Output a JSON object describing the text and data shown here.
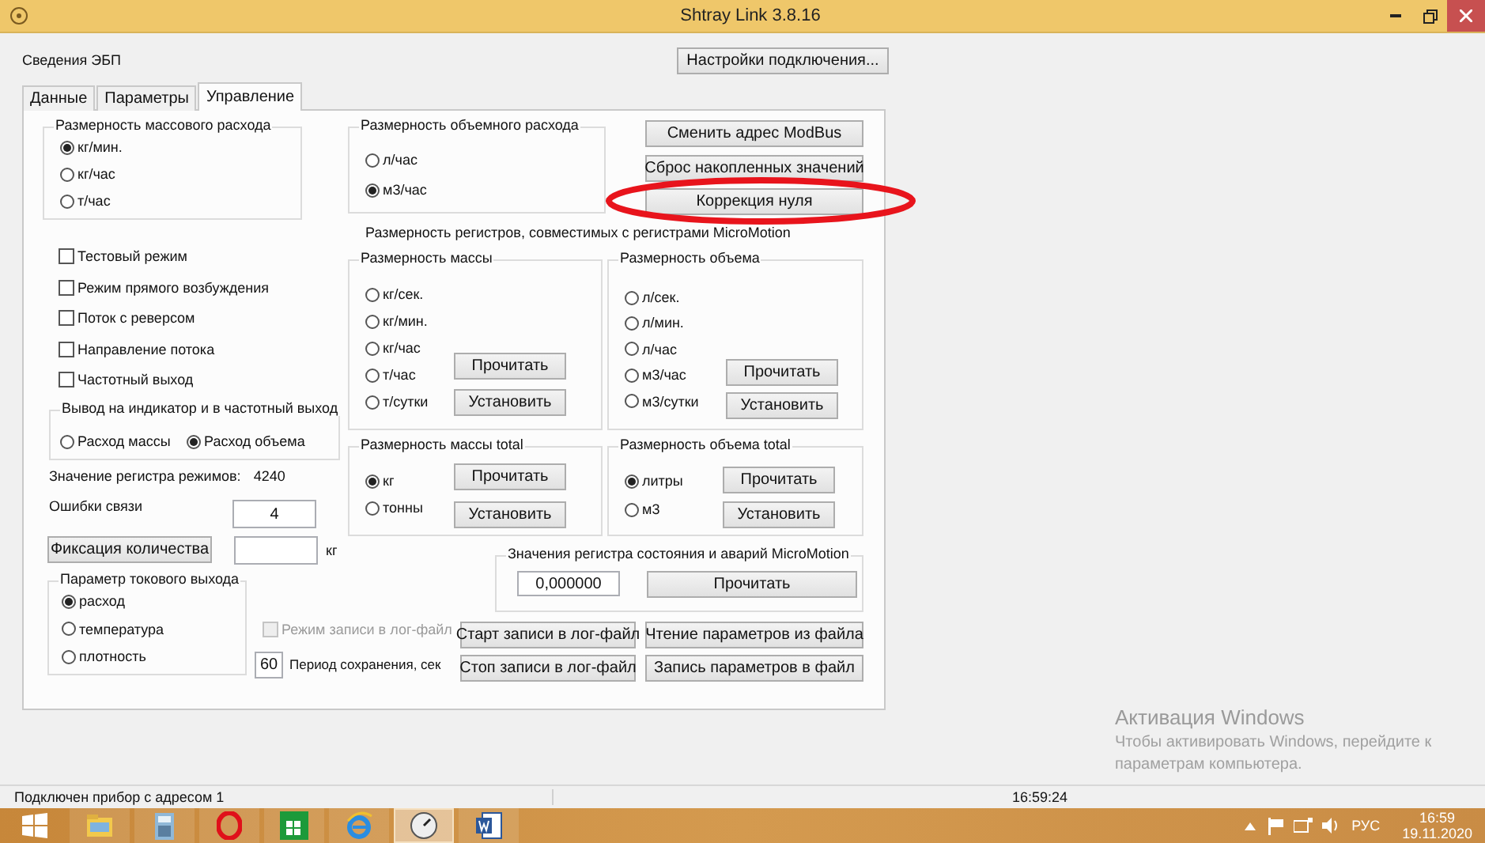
{
  "window": {
    "title": "Shtray Link 3.8.16"
  },
  "device_info_label": "Сведения ЭБП",
  "connection_settings_button": "Настройки подключения...",
  "tabs": [
    {
      "label": "Данные",
      "selected": false
    },
    {
      "label": "Параметры",
      "selected": false
    },
    {
      "label": "Управление",
      "selected": true
    }
  ],
  "mass_flow_units": {
    "title": "Размерность массового расхода",
    "options": [
      {
        "label": "кг/мин.",
        "selected": true
      },
      {
        "label": "кг/час",
        "selected": false
      },
      {
        "label": "т/час",
        "selected": false
      }
    ]
  },
  "volume_flow_units": {
    "title": "Размерность объемного расхода",
    "options": [
      {
        "label": "л/час",
        "selected": false
      },
      {
        "label": "м3/час",
        "selected": true
      }
    ]
  },
  "action_buttons": [
    "Сменить адрес ModBus",
    "Сброс накопленных значений",
    "Коррекция нуля"
  ],
  "modes": [
    {
      "label": "Тестовый режим",
      "checked": false
    },
    {
      "label": "Режим прямого возбуждения",
      "checked": false
    },
    {
      "label": "Поток с реверсом",
      "checked": false
    },
    {
      "label": "Направление потока",
      "checked": false
    },
    {
      "label": "Частотный выход",
      "checked": false
    }
  ],
  "registers_caption": "Размерность регистров, совместимых с регистрами MicroMotion",
  "mass_units": {
    "title": "Размерность массы",
    "options": [
      {
        "label": "кг/сек.",
        "selected": false
      },
      {
        "label": "кг/мин.",
        "selected": false
      },
      {
        "label": "кг/час",
        "selected": false
      },
      {
        "label": "т/час",
        "selected": false
      },
      {
        "label": "т/сутки",
        "selected": false
      }
    ],
    "buttons": [
      "Прочитать",
      "Установить"
    ]
  },
  "volume_units": {
    "title": "Размерность объема",
    "options": [
      {
        "label": "л/сек.",
        "selected": false
      },
      {
        "label": "л/мин.",
        "selected": false
      },
      {
        "label": "л/час",
        "selected": false
      },
      {
        "label": "м3/час",
        "selected": false
      },
      {
        "label": "м3/сутки",
        "selected": false
      }
    ],
    "buttons": [
      "Прочитать",
      "Установить"
    ]
  },
  "indicator_output": {
    "title": "Вывод на индикатор  и в частотный выход",
    "options": [
      {
        "label": "Расход массы",
        "selected": false
      },
      {
        "label": "Расход объема",
        "selected": true
      }
    ]
  },
  "mass_total_units": {
    "title": "Размерность массы total",
    "options": [
      {
        "label": "кг",
        "selected": true
      },
      {
        "label": "тонны",
        "selected": false
      }
    ],
    "buttons": [
      "Прочитать",
      "Установить"
    ]
  },
  "volume_total_units": {
    "title": "Размерность объема total",
    "options": [
      {
        "label": "литры",
        "selected": true
      },
      {
        "label": "м3",
        "selected": false
      }
    ],
    "buttons": [
      "Прочитать",
      "Установить"
    ]
  },
  "mode_register": {
    "label": "Значение регистра режимов:",
    "value": "4240"
  },
  "comm_errors": {
    "label": "Ошибки связи",
    "value": "4"
  },
  "fix_quantity": {
    "button": "Фиксация количества",
    "unit": "кг"
  },
  "current_output": {
    "title": "Параметр токового выхода",
    "options": [
      {
        "label": "расход",
        "selected": true
      },
      {
        "label": "температура",
        "selected": false
      },
      {
        "label": "плотность",
        "selected": false
      }
    ]
  },
  "status_register": {
    "title": "Значения регистра состояния и аварий MicroMotion",
    "value": "0,000000",
    "button": "Прочитать"
  },
  "log": {
    "mode_label": "Режим записи в лог-файл",
    "mode_checked": false,
    "mode_disabled": true,
    "period_value": "60",
    "period_label": "Период сохранения, сек",
    "start_button": "Старт записи в лог-файл",
    "stop_button": "Стоп записи в лог-файл"
  },
  "file_buttons": [
    "Чтение параметров из файла",
    "Запись параметров в файл"
  ],
  "activation_notice": {
    "title": "Активация Windows",
    "text": "Чтобы активировать Windows, перейдите к параметрам компьютера."
  },
  "status_bar": {
    "message": "Подключен прибор с адресом 1",
    "time": "16:59:24"
  },
  "taskbar": {
    "apps": [
      {
        "kind": "folder",
        "selected": false
      },
      {
        "kind": "calculator",
        "selected": false
      },
      {
        "kind": "opera",
        "selected": false
      },
      {
        "kind": "store",
        "selected": false
      },
      {
        "kind": "browser",
        "selected": false
      },
      {
        "kind": "gauge",
        "selected": true
      },
      {
        "kind": "word",
        "selected": false
      }
    ],
    "language": "РУС",
    "time": "16:59",
    "date": "19.11.2020"
  }
}
